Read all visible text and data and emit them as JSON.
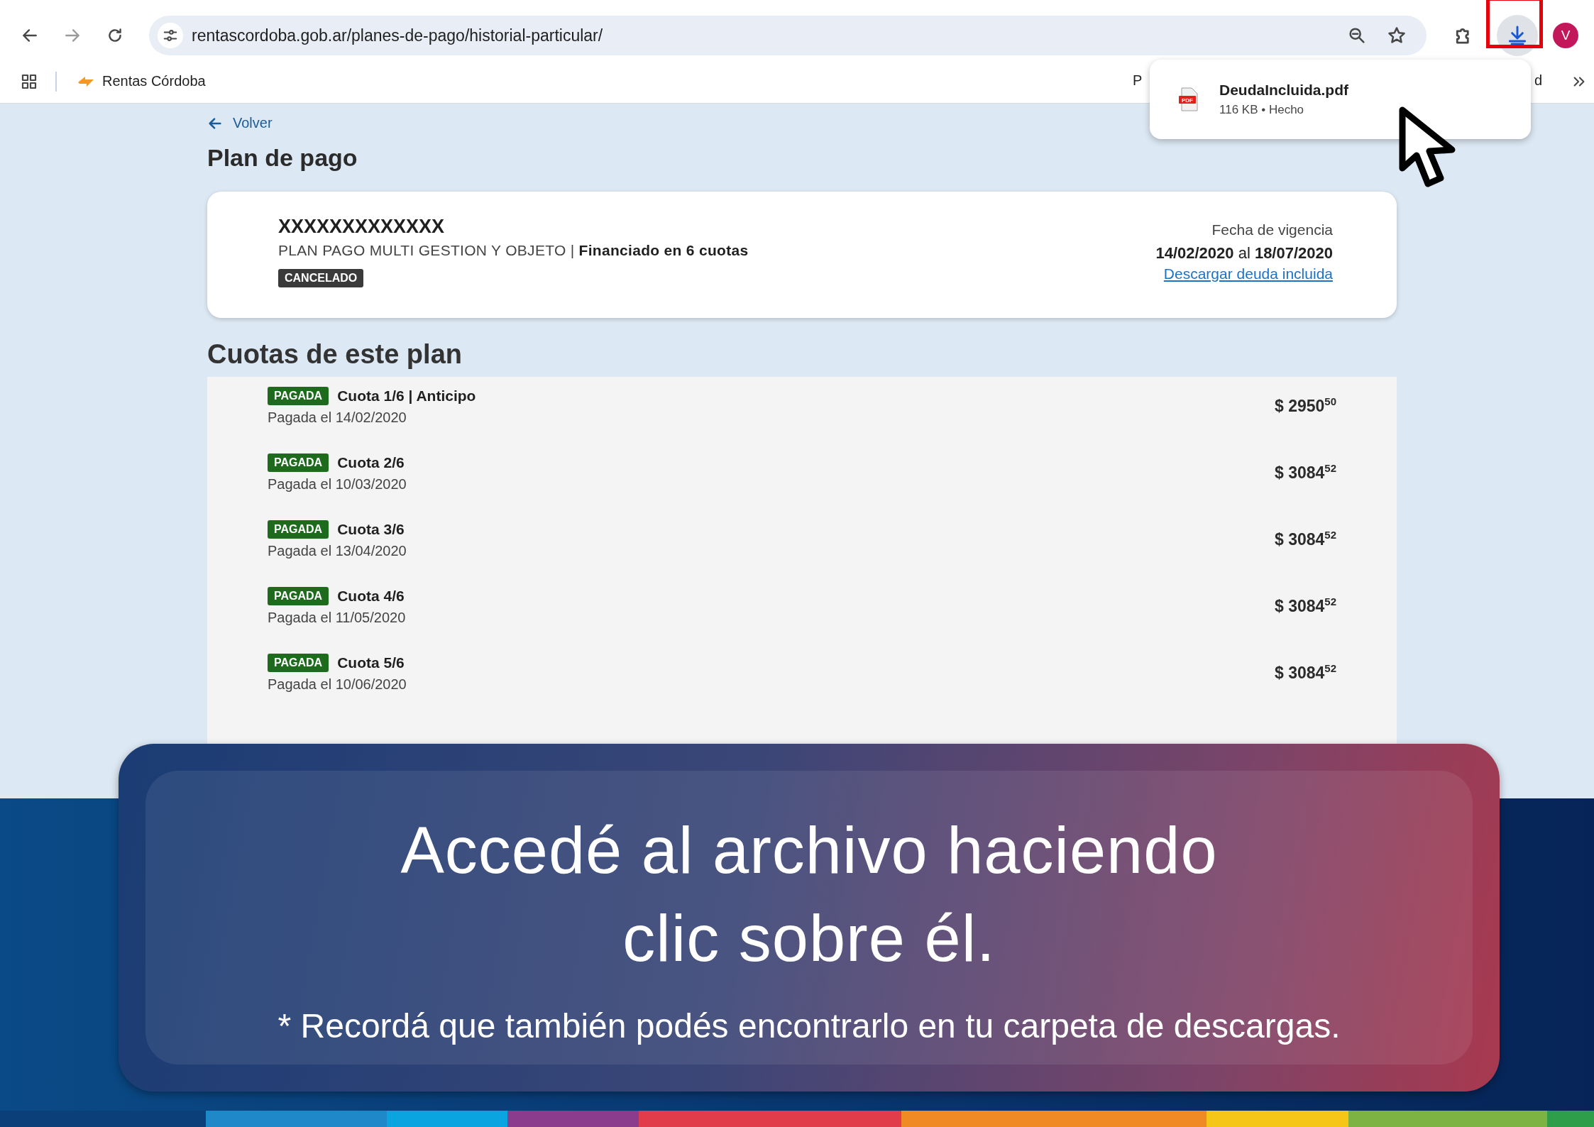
{
  "browser": {
    "url": "rentascordoba.gob.ar/planes-de-pago/historial-particular/",
    "avatar": "V",
    "bookmarks": [
      {
        "label": "Rentas Córdoba"
      }
    ],
    "hidden_bookmark_fragments": [
      "P",
      "d"
    ]
  },
  "download_popup": {
    "file_badge": "PDF",
    "file_name": "DeudaIncluida.pdf",
    "details": "116 KB • Hecho"
  },
  "page": {
    "back_link": "Volver",
    "title": "Plan de pago",
    "plan": {
      "name": "XXXXXXXXXXXXX",
      "description": "PLAN PAGO MULTI GESTION Y OBJETO | **Financiado en 6 cuotas**",
      "status": "CANCELADO",
      "validity_label": "Fecha de vigencia",
      "validity_dates": "**14/02/2020** al **18/07/2020**",
      "download_link": "Descargar deuda incluida"
    },
    "installments_title": "Cuotas de este plan",
    "installments": [
      {
        "status": "PAGADA",
        "title": "Cuota 1/6 | Anticipo",
        "paid_on": "Pagada el 14/02/2020",
        "amount": "$ 2950$^{50}$"
      },
      {
        "status": "PAGADA",
        "title": "Cuota 2/6",
        "paid_on": "Pagada el 10/03/2020",
        "amount": "$ 3084$^{52}$"
      },
      {
        "status": "PAGADA",
        "title": "Cuota 3/6",
        "paid_on": "Pagada el 13/04/2020",
        "amount": "$ 3084$^{52}$"
      },
      {
        "status": "PAGADA",
        "title": "Cuota 4/6",
        "paid_on": "Pagada el 11/05/2020",
        "amount": "$ 3084$^{52}$"
      },
      {
        "status": "PAGADA",
        "title": "Cuota 5/6",
        "paid_on": "Pagada el 10/06/2020",
        "amount": "$ 3084$^{52}$"
      }
    ]
  },
  "banner": {
    "title_lines": [
      "Accedé al archivo haciendo",
      "clic sobre él."
    ],
    "note": "* Recordá que también podés encontrarlo en tu carpeta de descargas."
  }
}
